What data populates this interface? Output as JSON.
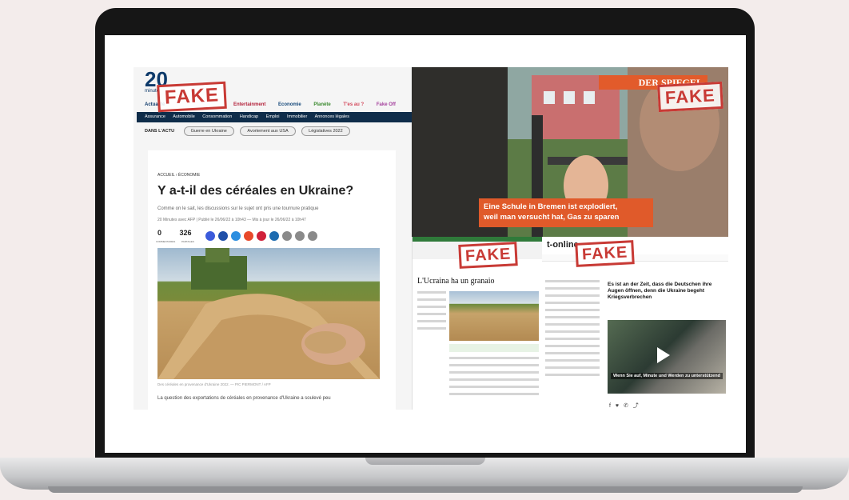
{
  "stamp": {
    "text": "FAKE",
    "color": "#c83a35"
  },
  "site_20min": {
    "logo_mark": "20",
    "logo_small": "minute",
    "nav": [
      "Actualité",
      "Entertainment",
      "Economie",
      "Planète",
      "T'es au ?",
      "Fake Off"
    ],
    "subnav": [
      "Assurance",
      "Automobile",
      "Consommation",
      "Handicap",
      "Emploi",
      "Immobilier",
      "Annonces légales"
    ],
    "dans_lactu": "DANS L'ACTU",
    "chips": [
      "Guerre en Ukraine",
      "Avortement aux USA",
      "Législatives 2022"
    ],
    "breadcrumb": "ACCUEIL › ÉCONOMIE",
    "headline": "Y a-t-il des céréales en Ukraine?",
    "subhead": "Comme on le sait, les discussions sur le sujet ont pris une tournure pratique",
    "meta": "20 Minutes avec AFP  |  Publié le 26/06/22 à 10h43 — Mis à jour le 26/06/22 à 10h47",
    "comments": "0",
    "comments_label": "COMMENTAIRES",
    "shares": "326",
    "shares_label": "PARTAGES",
    "caption": "Des céréales en provenance d'Ukraine 2022. — PIC PIERMONT / AFP",
    "lead": "La question des exportations de céréales en provenance d'Ukraine a soulevé peu"
  },
  "site_spiegel": {
    "header": "DER SPIEGEL",
    "subtitle_line1": "Eine Schule in Bremen ist explodiert,",
    "subtitle_line2": "weil man versucht hat, Gas zu sparen"
  },
  "site_lemonde": {
    "headline": "L'Ucraina ha un granaio"
  },
  "site_tonline": {
    "logo": "t-online",
    "headline": "Es ist an der Zeit, dass die Deutschen ihre Augen öffnen, denn die Ukraine begeht Kriegsverbrechen",
    "video_caption": "Wenn Sie auf, Minute und Werden zu unterstützend"
  }
}
